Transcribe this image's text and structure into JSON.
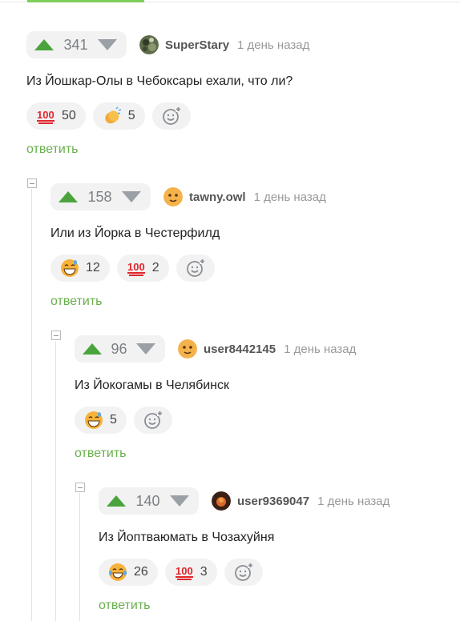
{
  "reply_label": "ответить",
  "colors": {
    "accent_green": "#6ab04c",
    "upvote": "#4aa43b"
  },
  "comments": [
    {
      "score": "341",
      "author": "SuperStary",
      "time": "1 день назад",
      "text": "Из Йошкар-Олы в Чебоксары ехали, что ли?",
      "avatar": "camo-avatar",
      "reactions": [
        {
          "icon": "hundred-points-icon",
          "count": "50"
        },
        {
          "icon": "clapping-hands-icon",
          "count": "5"
        }
      ]
    },
    {
      "score": "158",
      "author": "tawny.owl",
      "time": "1 день назад",
      "text": "Или из Йорка в Честерфилд",
      "avatar": "smiley-avatar",
      "reactions": [
        {
          "icon": "grinning-sweat-icon",
          "count": "12"
        },
        {
          "icon": "hundred-points-icon",
          "count": "2"
        }
      ]
    },
    {
      "score": "96",
      "author": "user8442145",
      "time": "1 день назад",
      "text": "Из Йокогамы в Челябинск",
      "avatar": "smiley-avatar",
      "reactions": [
        {
          "icon": "grinning-sweat-icon",
          "count": "5"
        }
      ]
    },
    {
      "score": "140",
      "author": "user9369047",
      "time": "1 день назад",
      "text": "Из Йоптваюмать в Чозахуйня",
      "avatar": "dark-avatar",
      "reactions": [
        {
          "icon": "tears-of-joy-icon",
          "count": "26"
        },
        {
          "icon": "hundred-points-icon",
          "count": "3"
        }
      ]
    }
  ]
}
